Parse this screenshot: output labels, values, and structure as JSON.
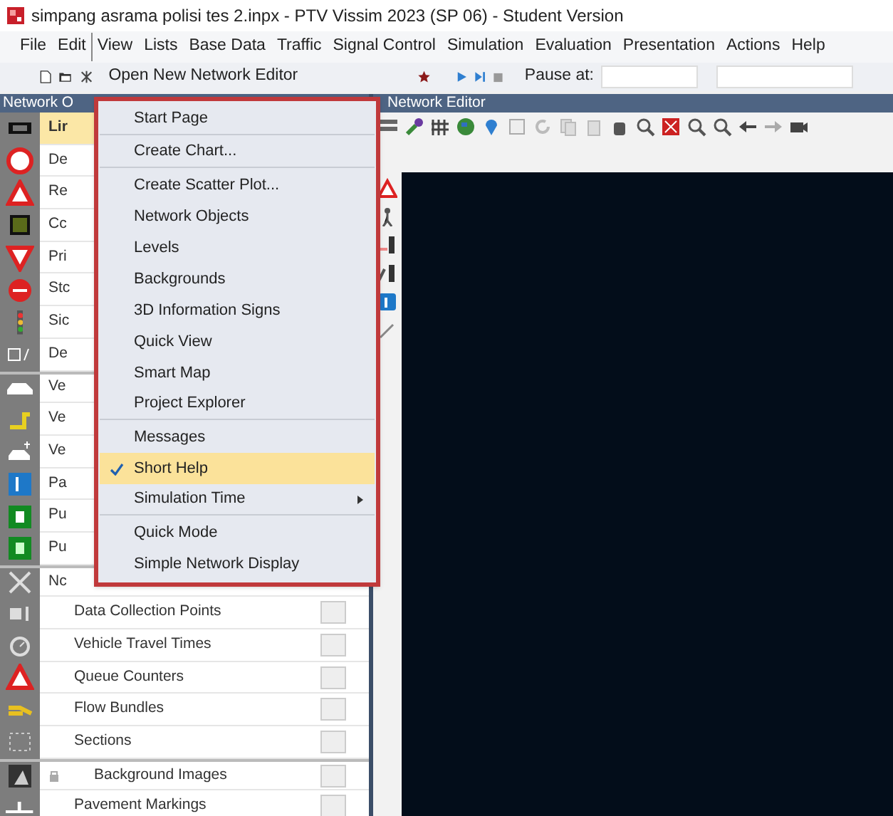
{
  "window": {
    "title": "simpang asrama polisi tes 2.inpx - PTV Vissim 2023 (SP 06) - Student Version"
  },
  "menu_bar": [
    {
      "label": "File",
      "selected": false
    },
    {
      "label": "Edit",
      "selected": false
    },
    {
      "label": "View",
      "selected": true
    },
    {
      "label": "Lists",
      "selected": false
    },
    {
      "label": "Base Data",
      "selected": false
    },
    {
      "label": "Traffic",
      "selected": false
    },
    {
      "label": "Signal Control",
      "selected": false
    },
    {
      "label": "Simulation",
      "selected": false
    },
    {
      "label": "Evaluation",
      "selected": false
    },
    {
      "label": "Presentation",
      "selected": false
    },
    {
      "label": "Actions",
      "selected": false
    },
    {
      "label": "Help",
      "selected": false
    }
  ],
  "toolbar": {
    "open_editor": "Open New Network Editor",
    "pause_label": "Pause at:"
  },
  "network_objects": {
    "title": "Network O",
    "items": [
      {
        "label": "Lir",
        "selected": true,
        "separator_before": false
      },
      {
        "label": "De",
        "selected": false,
        "separator_before": false
      },
      {
        "label": "Re",
        "selected": false,
        "separator_before": false
      },
      {
        "label": "Cc",
        "selected": false,
        "separator_before": false
      },
      {
        "label": "Pri",
        "selected": false,
        "separator_before": false
      },
      {
        "label": "Stc",
        "selected": false,
        "separator_before": false
      },
      {
        "label": "Sic",
        "selected": false,
        "separator_before": false
      },
      {
        "label": "De",
        "selected": false,
        "separator_before": false
      },
      {
        "label": "Ve",
        "selected": false,
        "separator_before": true
      },
      {
        "label": "Ve",
        "selected": false,
        "separator_before": false
      },
      {
        "label": "Ve",
        "selected": false,
        "separator_before": false
      },
      {
        "label": "Pa",
        "selected": false,
        "separator_before": false
      },
      {
        "label": "Pu",
        "selected": false,
        "separator_before": false
      },
      {
        "label": "Pu",
        "selected": false,
        "separator_before": false
      },
      {
        "label": "Nc",
        "selected": false,
        "separator_before": true
      },
      {
        "label": "Data Collection Points",
        "selected": false,
        "separator_before": false
      },
      {
        "label": "Vehicle Travel Times",
        "selected": false,
        "separator_before": false
      },
      {
        "label": "Queue Counters",
        "selected": false,
        "separator_before": false
      },
      {
        "label": "Flow Bundles",
        "selected": false,
        "separator_before": false
      },
      {
        "label": "Sections",
        "selected": false,
        "separator_before": false
      },
      {
        "label": "Background Images",
        "selected": false,
        "separator_before": true
      },
      {
        "label": "Pavement Markings",
        "selected": false,
        "separator_before": false
      }
    ]
  },
  "view_menu": [
    {
      "label": "Start Page",
      "checked": false,
      "selected": false,
      "kind": "item",
      "separator_after": true
    },
    {
      "label": "Create Chart...",
      "checked": false,
      "selected": false,
      "kind": "item",
      "separator_after": true
    },
    {
      "label": "Create Scatter Plot...",
      "checked": false,
      "selected": false,
      "kind": "item",
      "separator_after": false
    },
    {
      "label": "Network Objects",
      "checked": false,
      "selected": false,
      "kind": "item",
      "separator_after": false
    },
    {
      "label": "Levels",
      "checked": false,
      "selected": false,
      "kind": "item",
      "separator_after": false
    },
    {
      "label": "Backgrounds",
      "checked": false,
      "selected": false,
      "kind": "item",
      "separator_after": false
    },
    {
      "label": "3D Information Signs",
      "checked": false,
      "selected": false,
      "kind": "item",
      "separator_after": false
    },
    {
      "label": "Quick View",
      "checked": false,
      "selected": false,
      "kind": "item",
      "separator_after": false
    },
    {
      "label": "Smart Map",
      "checked": false,
      "selected": false,
      "kind": "item",
      "separator_after": false
    },
    {
      "label": "Project Explorer",
      "checked": false,
      "selected": false,
      "kind": "item",
      "separator_after": true
    },
    {
      "label": "Messages",
      "checked": false,
      "selected": false,
      "kind": "item",
      "separator_after": false
    },
    {
      "label": "Short Help",
      "checked": true,
      "selected": true,
      "kind": "item",
      "separator_after": false
    },
    {
      "label": "Simulation Time",
      "checked": false,
      "selected": false,
      "kind": "submenu",
      "separator_after": true
    },
    {
      "label": "Quick Mode",
      "checked": false,
      "selected": false,
      "kind": "item",
      "separator_after": false
    },
    {
      "label": "Simple Network Display",
      "checked": false,
      "selected": false,
      "kind": "item",
      "separator_after": false
    }
  ],
  "network_editor": {
    "title": "Network Editor"
  }
}
